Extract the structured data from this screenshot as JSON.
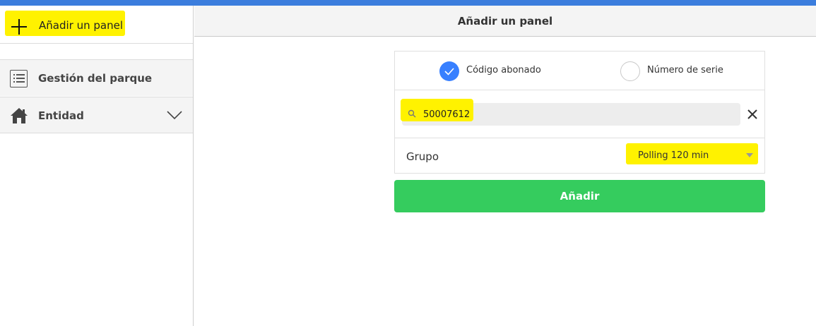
{
  "colors": {
    "topbar": "#3b7ddd",
    "highlight": "#fff200",
    "primary_button": "#35cc5e",
    "radio_checked": "#3880ff"
  },
  "sidebar": {
    "add_panel": {
      "label": "Añadir un panel",
      "icon": "plus-icon"
    },
    "items": [
      {
        "label": "Gestión del parque",
        "icon": "list-icon"
      },
      {
        "label": "Entidad",
        "icon": "home-icon",
        "trailing_icon": "chevron-down-icon"
      }
    ]
  },
  "main": {
    "title": "Añadir un panel",
    "mode_options": [
      {
        "label": "Código abonado",
        "selected": true
      },
      {
        "label": "Número de serie",
        "selected": false
      }
    ],
    "search": {
      "value": "50007612",
      "icon": "search-icon",
      "clear_icon": "close-icon"
    },
    "group": {
      "label": "Grupo",
      "selected": "Polling 120 min"
    },
    "add_button_label": "Añadir"
  }
}
